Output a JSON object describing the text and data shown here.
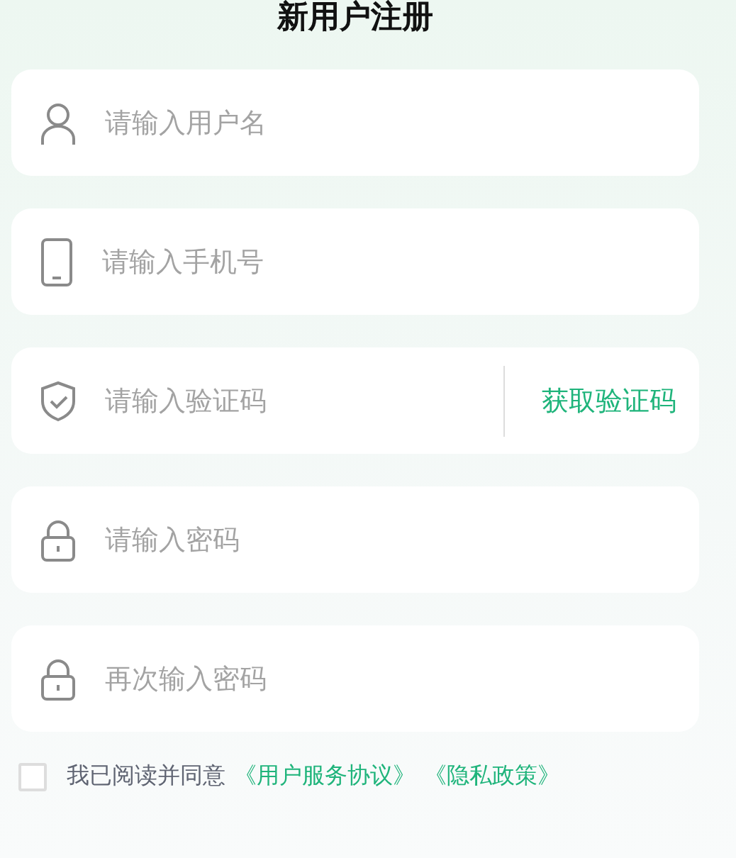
{
  "title": "新用户注册",
  "fields": [
    {
      "kind": "user",
      "placeholder": "请输入用户名"
    },
    {
      "kind": "phone",
      "placeholder": "请输入手机号"
    },
    {
      "kind": "shield",
      "placeholder": "请输入验证码",
      "action": "获取验证码"
    },
    {
      "kind": "lock",
      "placeholder": "请输入密码"
    },
    {
      "kind": "lock",
      "placeholder": "再次输入密码"
    }
  ],
  "agreement": {
    "checked": false,
    "text": "我已阅读并同意",
    "links": [
      "《用户服务协议》",
      "《隐私政策》"
    ]
  }
}
